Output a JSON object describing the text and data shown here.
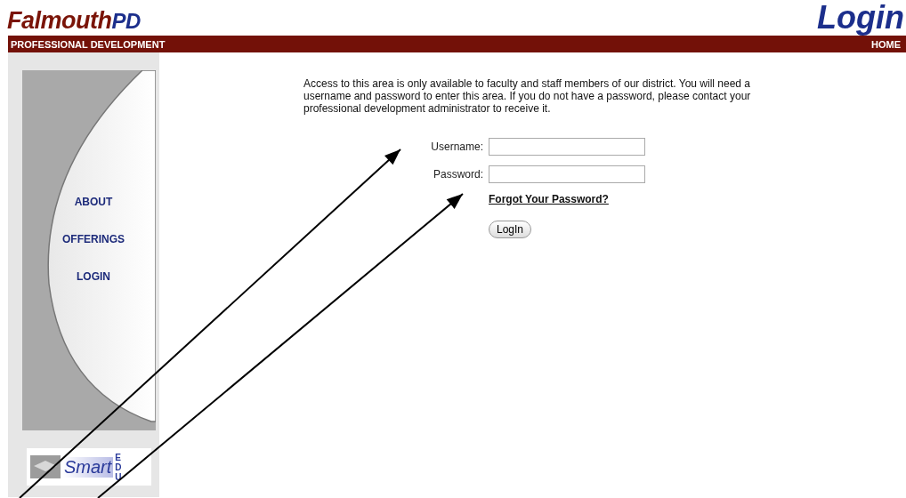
{
  "header": {
    "logo_main": "Falmouth",
    "logo_suffix": "PD",
    "page_title": "Login"
  },
  "nav_bar": {
    "section": "PROFESSIONAL DEVELOPMENT",
    "home_link": "HOME"
  },
  "sidebar": {
    "items": [
      {
        "label": "ABOUT"
      },
      {
        "label": "OFFERINGS"
      },
      {
        "label": "LOGIN"
      }
    ]
  },
  "sidebar_logo": {
    "word": "Smart",
    "side_text": "EDU"
  },
  "intro": "Access to this area is only available to faculty and staff members of our district. You will need a username and password to enter this area. If you do not have a password, please contact your professional development administrator to receive it.",
  "form": {
    "fields": [
      {
        "label": "Username:"
      },
      {
        "label": "Password:"
      }
    ],
    "forgot_link": "Forgot Your Password?",
    "submit": "LogIn"
  },
  "annotations": [
    {
      "kind": "arrow"
    },
    {
      "kind": "arrow"
    }
  ]
}
